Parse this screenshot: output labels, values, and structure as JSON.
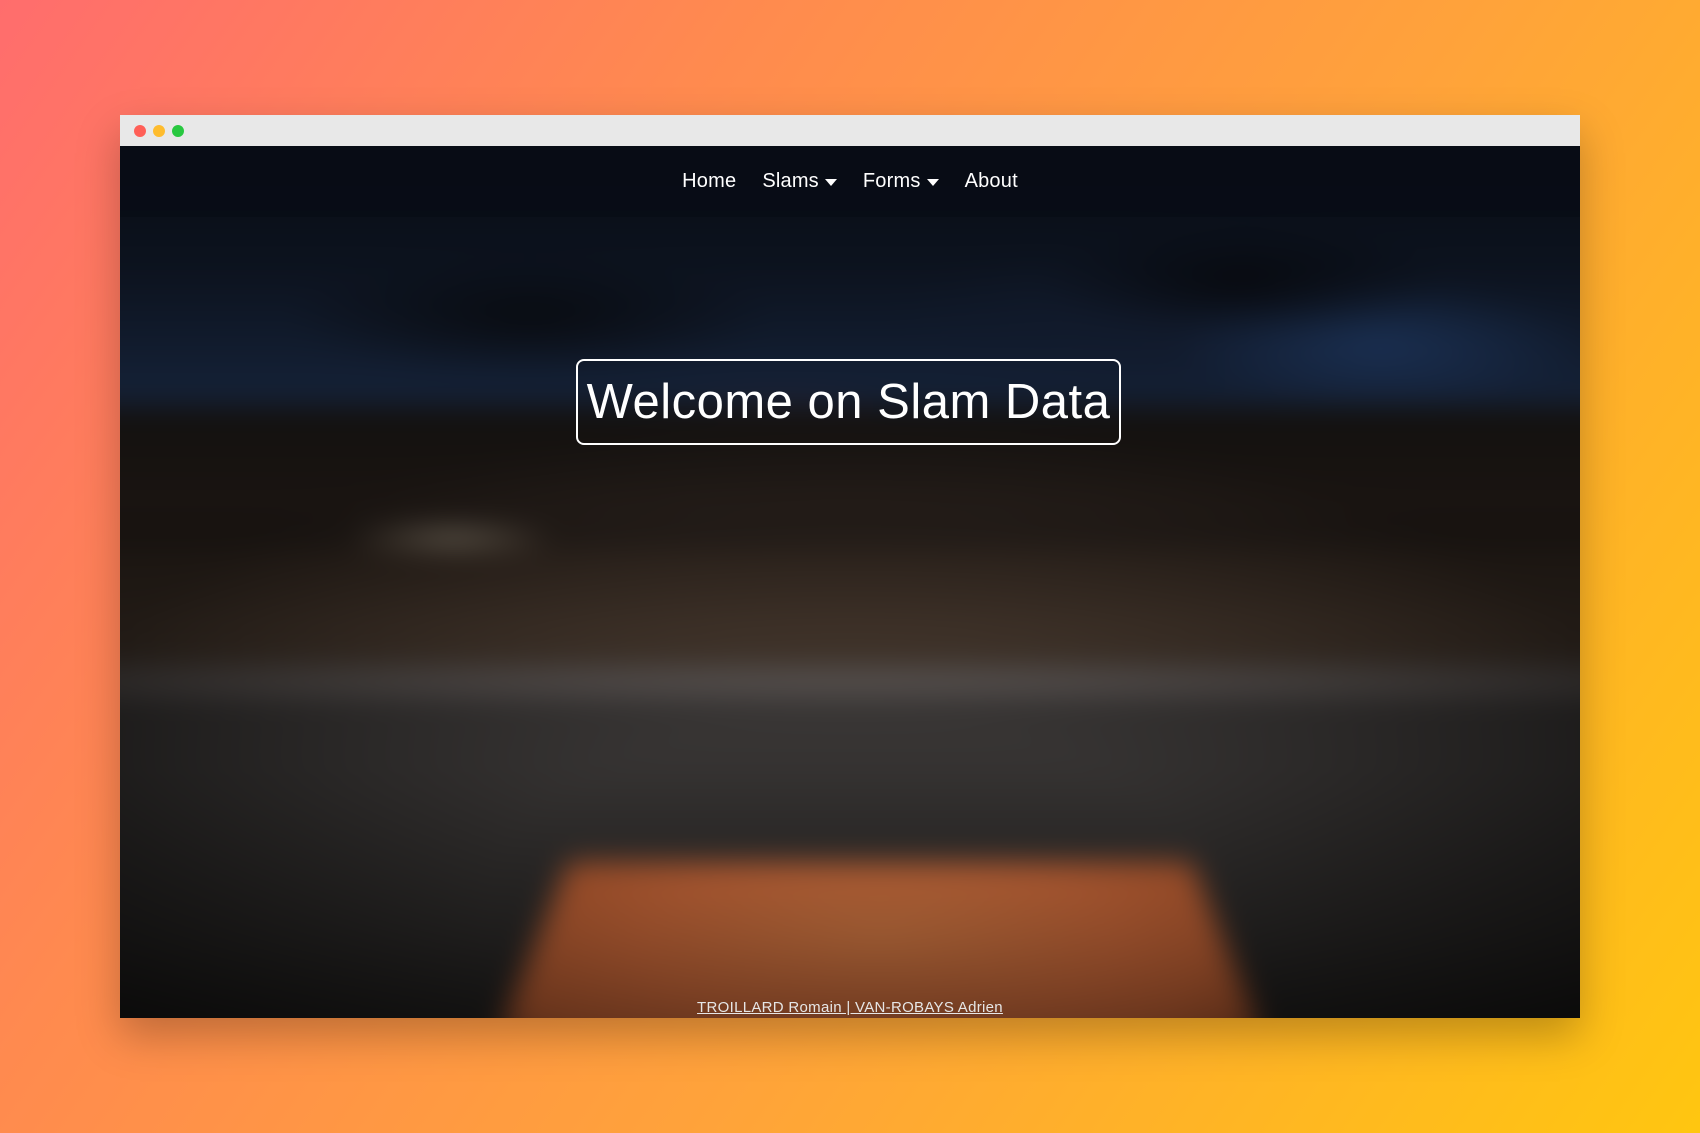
{
  "browser": {
    "buttons": [
      "close",
      "minimize",
      "maximize"
    ]
  },
  "navbar": {
    "items": [
      {
        "label": "Home",
        "has_dropdown": false
      },
      {
        "label": "Slams",
        "has_dropdown": true
      },
      {
        "label": "Forms",
        "has_dropdown": true
      },
      {
        "label": "About",
        "has_dropdown": false
      }
    ]
  },
  "hero": {
    "title": "Welcome on Slam Data",
    "background": "blurred tennis stadium clay court"
  },
  "footer": {
    "credits": "TROILLARD Romain | VAN-ROBAYS Adrien"
  },
  "colors": {
    "page_gradient_start": "#ff6d6d",
    "page_gradient_end": "#ffc610",
    "navbar_bg": "#080c16",
    "text": "#ffffff"
  }
}
